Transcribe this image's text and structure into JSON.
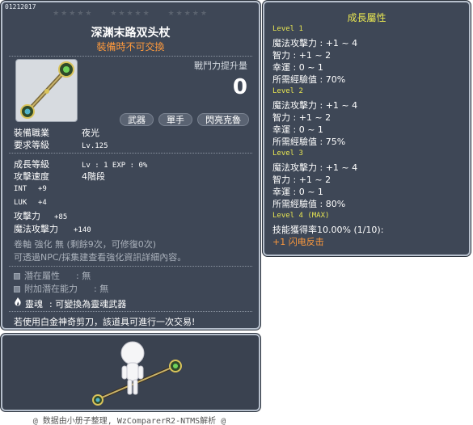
{
  "item": {
    "code": "01212017",
    "stars": [
      "★★★★★",
      "★★★★★",
      "★★★★★"
    ],
    "name": "深渊末路双头杖",
    "bind_notice": "裝備時不可交換",
    "damage_label": "戰鬥力提升量",
    "damage_value": "0",
    "tags": [
      "武器",
      "單手",
      "閃亮克魯"
    ],
    "job_label": "裝備職業",
    "job_value": "夜光",
    "level_label": "要求等級",
    "level_value": "Lv.125",
    "growth_label": "成長等級",
    "growth_value": "Lv : 1    EXP : 0%",
    "speed_label": "攻擊速度",
    "speed_value": "4階段",
    "stats": [
      {
        "k": "INT",
        "v": "+9"
      },
      {
        "k": "LUK",
        "v": "+4"
      },
      {
        "k": "攻擊力",
        "v": "+85"
      },
      {
        "k": "魔法攻擊力",
        "v": "+140"
      }
    ],
    "scroll_line": "卷軸 強化 無 (剩餘9次，可修復0次)",
    "npc_line": "可透過NPC/採集建查看強化資訊詳細內容。",
    "potential_label": "潛在屬性",
    "potential_value": ": 無",
    "addpot_label": "附加潛在能力",
    "addpot_value": ": 無",
    "soul_label": "靈魂",
    "soul_value": ": 可變換為靈魂武器",
    "scissors_line": "若使用白金神奇剪刀，該道具可進行一次交易!"
  },
  "growth": {
    "title": "成長屬性",
    "levels": [
      {
        "name": "Level 1",
        "lines": [
          "魔法攻擊力 : +1 ~ 4",
          "智力 : +1 ~ 2",
          "幸運 : 0 ~ 1",
          "所需經驗值 : 70%"
        ]
      },
      {
        "name": "Level 2",
        "lines": [
          "魔法攻擊力 : +1 ~ 4",
          "智力 : +1 ~ 2",
          "幸運 : 0 ~ 1",
          "所需經驗值 : 75%"
        ]
      },
      {
        "name": "Level 3",
        "lines": [
          "魔法攻擊力 : +1 ~ 4",
          "智力 : +1 ~ 2",
          "幸運 : 0 ~ 1",
          "所需經驗值 : 80%"
        ]
      },
      {
        "name": "Level 4 (MAX)",
        "lines": [
          "技能獲得率10.00% (1/10):"
        ]
      }
    ],
    "skill": "+1 闪电反击"
  },
  "footer": "@ 数据由小册子整理, WzComparerR2-NTMS解析 @",
  "icons": {
    "soul": "flame-icon",
    "weapon": "staff-icon",
    "character": "character-icon"
  }
}
